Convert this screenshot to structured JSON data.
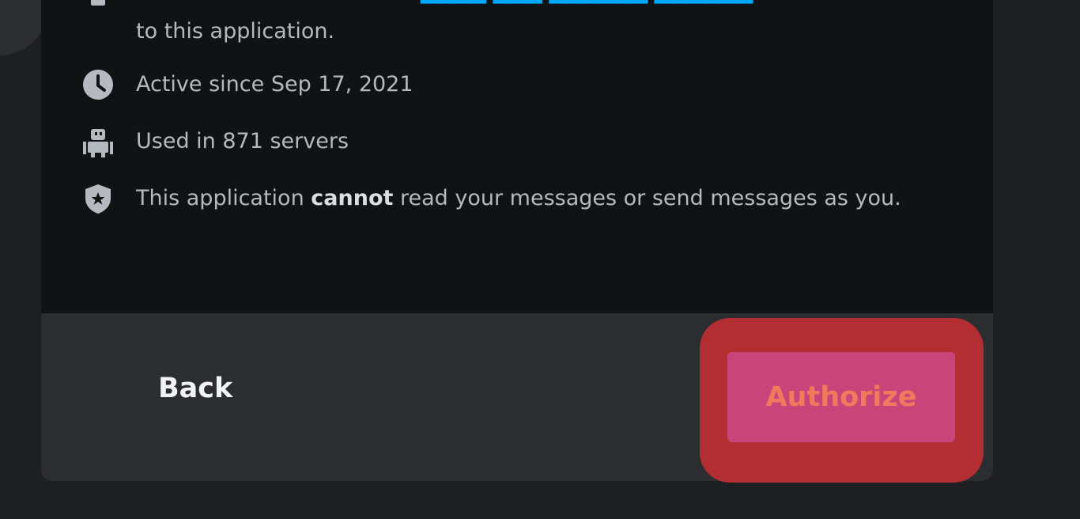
{
  "permissions": {
    "privacy_line_tail": "to this application.",
    "active_since": "Active since Sep 17, 2021",
    "servers": "Used in 871 servers",
    "cannot_read_prefix": "This application ",
    "cannot_read_bold": "cannot",
    "cannot_read_suffix": " read your messages or send messages as you."
  },
  "footer": {
    "back_label": "Back",
    "authorize_label": "Authorize"
  },
  "icons": {
    "privacy": "document-icon",
    "active": "clock-icon",
    "servers": "robot-icon",
    "security": "shield-star-icon"
  },
  "colors": {
    "link": "#00a8fc",
    "highlight": "#b22e33",
    "authorize_bg": "#c8457a",
    "authorize_text": "#f2795c"
  }
}
